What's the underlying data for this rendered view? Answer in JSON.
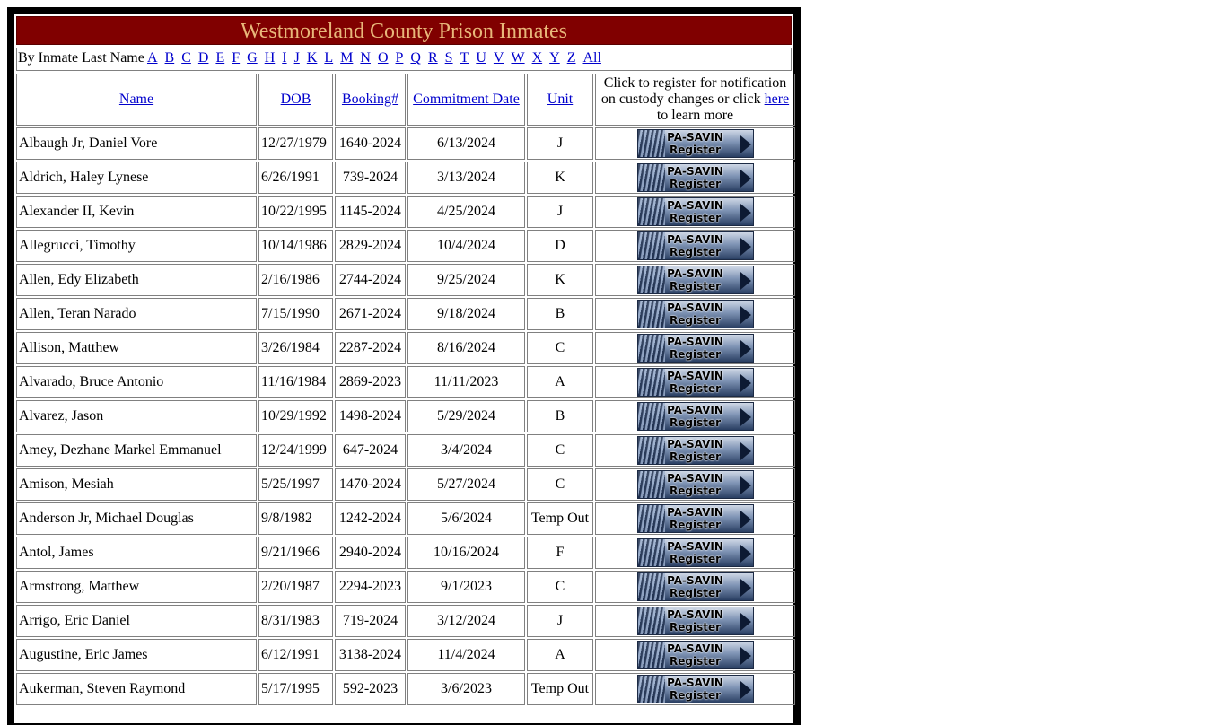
{
  "page": {
    "title": "Westmoreland County Prison Inmates"
  },
  "alpha_nav": {
    "label": "By Inmate Last Name",
    "letters": [
      "A",
      "B",
      "C",
      "D",
      "E",
      "F",
      "G",
      "H",
      "I",
      "J",
      "K",
      "L",
      "M",
      "N",
      "O",
      "P",
      "Q",
      "R",
      "S",
      "T",
      "U",
      "V",
      "W",
      "X",
      "Y",
      "Z",
      "All"
    ]
  },
  "table": {
    "headers": {
      "name": "Name",
      "dob": "DOB",
      "booking": "Booking#",
      "commitment": "Commitment Date",
      "unit": "Unit",
      "register_pre": "Click to register for notification on custody changes or click",
      "register_link": "here",
      "register_post": "to learn more"
    },
    "button": {
      "line1": "PA-SAVIN",
      "line2": "Register"
    },
    "rows": [
      {
        "name": "Albaugh Jr, Daniel Vore",
        "dob": "12/27/1979",
        "booking": "1640-2024",
        "commitment": "6/13/2024",
        "unit": "J"
      },
      {
        "name": "Aldrich, Haley Lynese",
        "dob": "6/26/1991",
        "booking": "739-2024",
        "commitment": "3/13/2024",
        "unit": "K"
      },
      {
        "name": "Alexander II, Kevin",
        "dob": "10/22/1995",
        "booking": "1145-2024",
        "commitment": "4/25/2024",
        "unit": "J"
      },
      {
        "name": "Allegrucci, Timothy",
        "dob": "10/14/1986",
        "booking": "2829-2024",
        "commitment": "10/4/2024",
        "unit": "D"
      },
      {
        "name": "Allen, Edy Elizabeth",
        "dob": "2/16/1986",
        "booking": "2744-2024",
        "commitment": "9/25/2024",
        "unit": "K"
      },
      {
        "name": "Allen, Teran Narado",
        "dob": "7/15/1990",
        "booking": "2671-2024",
        "commitment": "9/18/2024",
        "unit": "B"
      },
      {
        "name": "Allison, Matthew",
        "dob": "3/26/1984",
        "booking": "2287-2024",
        "commitment": "8/16/2024",
        "unit": "C"
      },
      {
        "name": "Alvarado, Bruce Antonio",
        "dob": "11/16/1984",
        "booking": "2869-2023",
        "commitment": "11/11/2023",
        "unit": "A"
      },
      {
        "name": "Alvarez, Jason",
        "dob": "10/29/1992",
        "booking": "1498-2024",
        "commitment": "5/29/2024",
        "unit": "B"
      },
      {
        "name": "Amey, Dezhane Markel Emmanuel",
        "dob": "12/24/1999",
        "booking": "647-2024",
        "commitment": "3/4/2024",
        "unit": "C"
      },
      {
        "name": "Amison, Mesiah",
        "dob": "5/25/1997",
        "booking": "1470-2024",
        "commitment": "5/27/2024",
        "unit": "C"
      },
      {
        "name": "Anderson Jr, Michael Douglas",
        "dob": "9/8/1982",
        "booking": "1242-2024",
        "commitment": "5/6/2024",
        "unit": "Temp Out"
      },
      {
        "name": "Antol, James",
        "dob": "9/21/1966",
        "booking": "2940-2024",
        "commitment": "10/16/2024",
        "unit": "F"
      },
      {
        "name": "Armstrong, Matthew",
        "dob": "2/20/1987",
        "booking": "2294-2023",
        "commitment": "9/1/2023",
        "unit": "C"
      },
      {
        "name": "Arrigo, Eric Daniel",
        "dob": "8/31/1983",
        "booking": "719-2024",
        "commitment": "3/12/2024",
        "unit": "J"
      },
      {
        "name": "Augustine, Eric James",
        "dob": "6/12/1991",
        "booking": "3138-2024",
        "commitment": "11/4/2024",
        "unit": "A"
      },
      {
        "name": "Aukerman, Steven Raymond",
        "dob": "5/17/1995",
        "booking": "592-2023",
        "commitment": "3/6/2023",
        "unit": "Temp Out"
      }
    ]
  }
}
